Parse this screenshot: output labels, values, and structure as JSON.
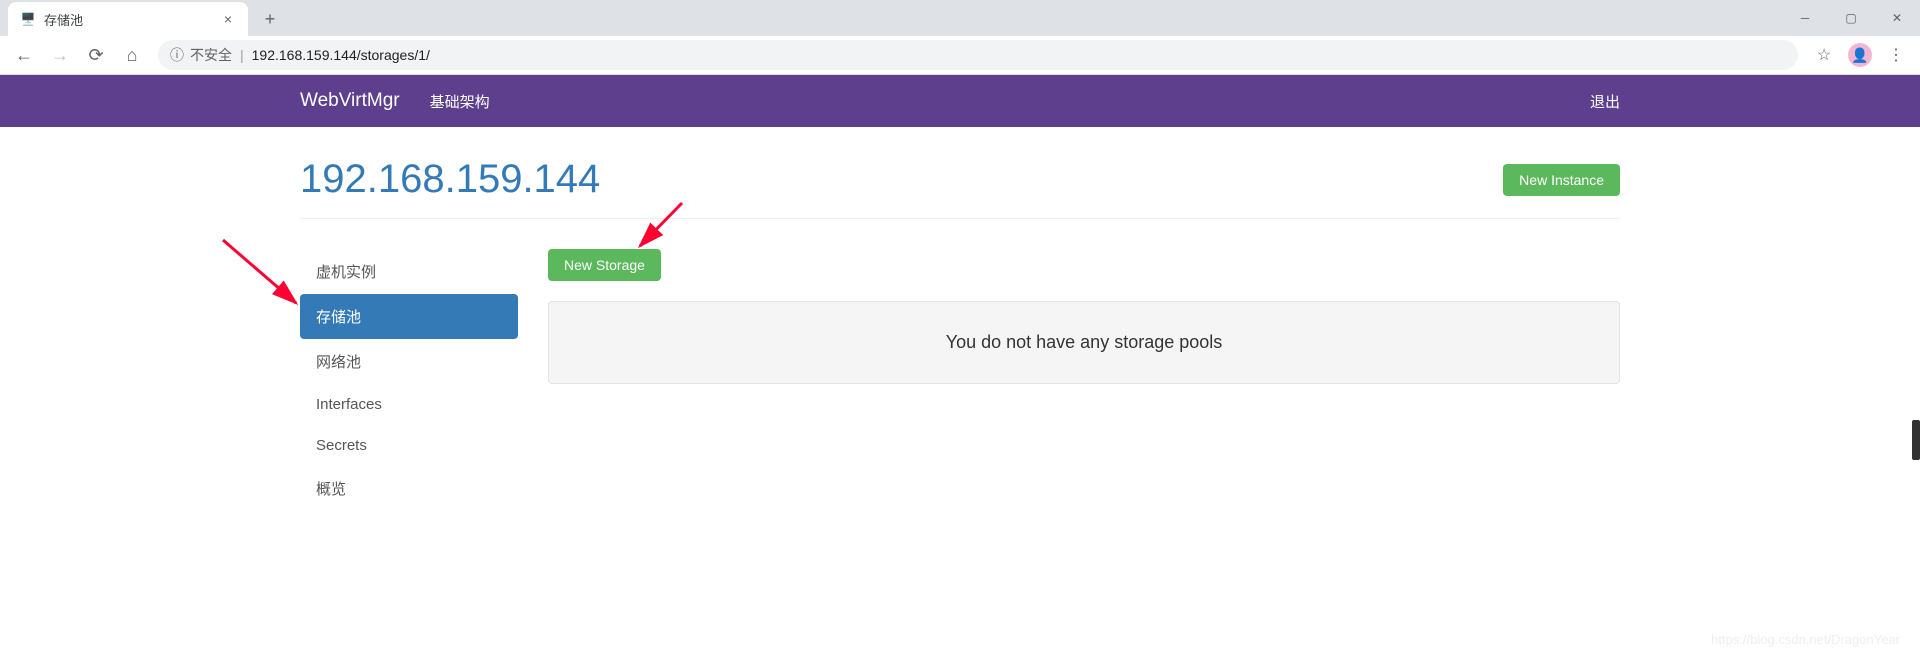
{
  "browser": {
    "tab_title": "存储池",
    "security_label": "不安全",
    "url": "192.168.159.144/storages/1/"
  },
  "navbar": {
    "brand": "WebVirtMgr",
    "infrastructure": "基础架构",
    "logout": "退出"
  },
  "page": {
    "title": "192.168.159.144",
    "new_instance": "New Instance",
    "new_storage": "New Storage",
    "empty_message": "You do not have any storage pools"
  },
  "sidebar": {
    "items": [
      {
        "label": "虚机实例",
        "active": false
      },
      {
        "label": "存储池",
        "active": true
      },
      {
        "label": "网络池",
        "active": false
      },
      {
        "label": "Interfaces",
        "active": false
      },
      {
        "label": "Secrets",
        "active": false
      },
      {
        "label": "概览",
        "active": false
      }
    ]
  },
  "watermark": "https://blog.csdn.net/DragonYear"
}
